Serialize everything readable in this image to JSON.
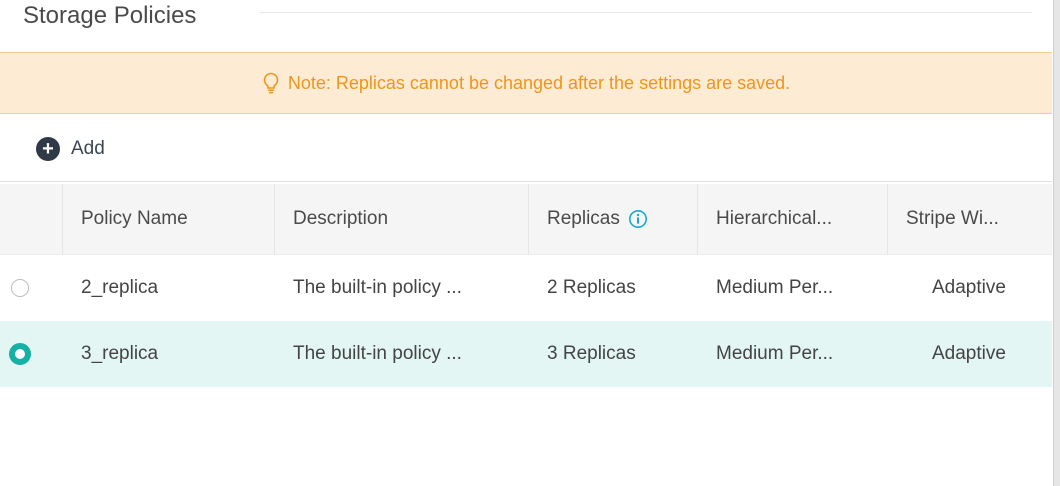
{
  "page": {
    "title": "Storage Policies"
  },
  "note": {
    "icon": "lightbulb-icon",
    "text": "Note: Replicas cannot be changed after the settings are saved.",
    "color": "#f0951c",
    "background": "#fdebd3"
  },
  "toolbar": {
    "add_label": "Add",
    "add_icon": "plus-circle-icon"
  },
  "table": {
    "columns": [
      "Policy Name",
      "Description",
      "Replicas",
      "Hierarchical...",
      "Stripe Wi..."
    ],
    "replicas_info_icon": "info-icon",
    "rows": [
      {
        "selected": false,
        "cells": [
          "2_replica",
          "The built-in policy ...",
          "2 Replicas",
          "Medium Per...",
          "Adaptive"
        ]
      },
      {
        "selected": true,
        "cells": [
          "3_replica",
          "The built-in policy ...",
          "3 Replicas",
          "Medium Per...",
          "Adaptive"
        ]
      }
    ],
    "selected_row_color": "#e4f6f3",
    "accent": "#16b1a4"
  }
}
